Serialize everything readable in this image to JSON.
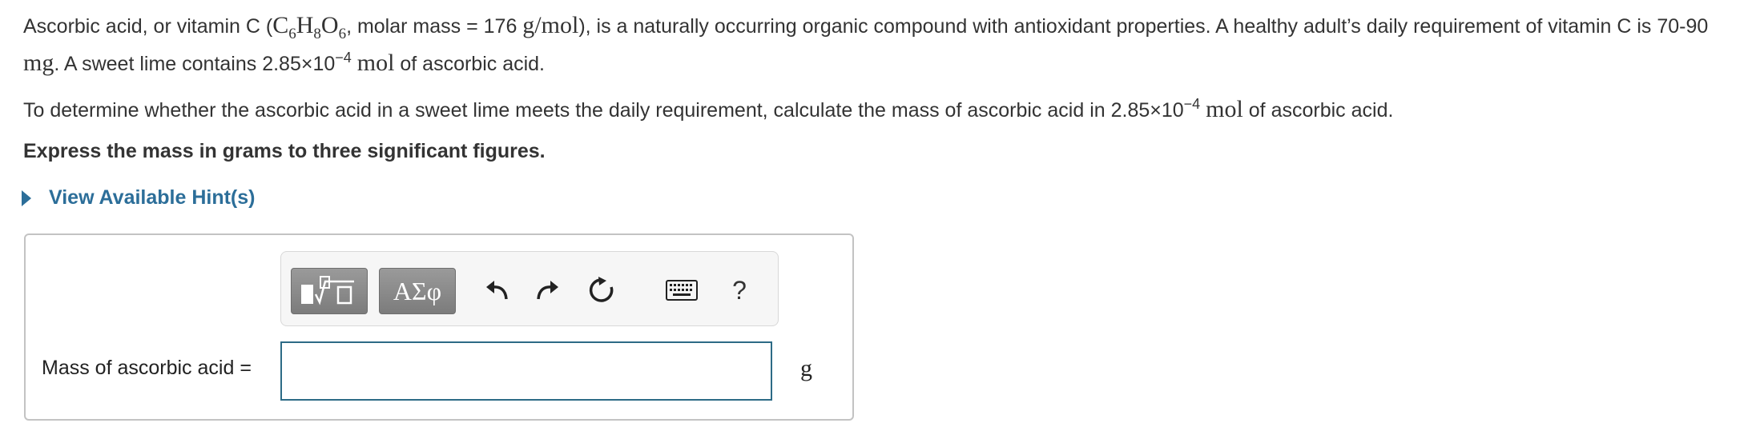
{
  "problem": {
    "intro_a": "Ascorbic acid, or vitamin C (",
    "formula_c": "C",
    "formula_c_sub": "6",
    "formula_h": "H",
    "formula_h_sub": "8",
    "formula_o": "O",
    "formula_o_sub": "6",
    "intro_b": ", molar mass = 176 ",
    "unit_gmol": "g/mol",
    "intro_c": "), is a naturally occurring organic compound with antioxidant properties. A healthy adult’s daily requirement of vitamin C is 70-90 ",
    "unit_mg": "mg",
    "intro_d": ". A sweet lime contains 2.85×10",
    "exponent": "−4",
    "unit_mol": "mol",
    "intro_e": " of ascorbic acid.",
    "q_a": "To determine whether the ascorbic acid in a sweet lime meets the daily requirement, calculate the mass of ascorbic acid in 2.85×10",
    "q_exponent": "−4",
    "q_unit_mol": "mol",
    "q_b": " of ascorbic acid.",
    "instruction": "Express the mass in grams to three significant figures."
  },
  "hint": {
    "label": "View Available Hint(s)"
  },
  "toolbar": {
    "templates_icon": "templates-icon",
    "greek_label": "ΑΣφ",
    "undo_icon": "undo-icon",
    "redo_icon": "redo-icon",
    "reset_icon": "reset-icon",
    "keyboard_icon": "keyboard-icon",
    "help_label": "?"
  },
  "answer": {
    "label": "Mass of ascorbic acid =",
    "value": "",
    "unit": "g"
  },
  "colors": {
    "link": "#2c6e99",
    "input_border": "#2d6b86",
    "box_border": "#c3c3c3"
  }
}
